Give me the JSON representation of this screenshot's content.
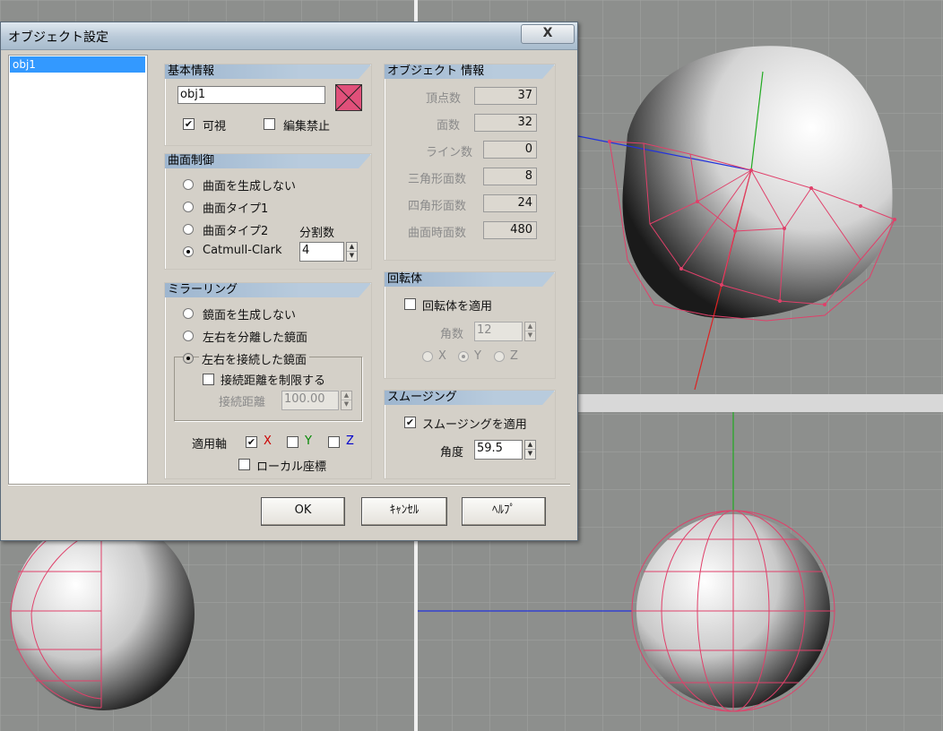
{
  "dialog": {
    "title": "オブジェクト設定",
    "close_label": "X",
    "object_list": [
      "obj1"
    ]
  },
  "basic_info": {
    "header": "基本情報",
    "name_value": "obj1",
    "color": "#e0507a",
    "visible_label": "可視",
    "visible_checked": true,
    "lock_label": "編集禁止",
    "lock_checked": false
  },
  "surface": {
    "header": "曲面制御",
    "options": [
      "曲面を生成しない",
      "曲面タイプ1",
      "曲面タイプ2",
      "Catmull-Clark"
    ],
    "selected_index": 3,
    "subdiv_label": "分割数",
    "subdiv_value": "4"
  },
  "mirror": {
    "header": "ミラーリング",
    "options": [
      "鏡面を生成しない",
      "左右を分離した鏡面",
      "左右を接続した鏡面"
    ],
    "selected_index": 2,
    "limit_label": "接続距離を制限する",
    "limit_checked": false,
    "distance_label": "接続距離",
    "distance_value": "100.00",
    "axis_label": "適用軸",
    "axis_x": "X",
    "axis_y": "Y",
    "axis_z": "Z",
    "axis_x_checked": true,
    "axis_y_checked": false,
    "axis_z_checked": false,
    "axis_x_color": "#cc0000",
    "axis_y_color": "#008800",
    "axis_z_color": "#0000cc",
    "local_label": "ローカル座標",
    "local_checked": false
  },
  "object_info": {
    "header": "オブジェクト 情報",
    "rows": [
      {
        "label": "頂点数",
        "value": "37"
      },
      {
        "label": "面数",
        "value": "32"
      },
      {
        "label": "ライン数",
        "value": "0"
      },
      {
        "label": "三角形面数",
        "value": "8"
      },
      {
        "label": "四角形面数",
        "value": "24"
      },
      {
        "label": "曲面時面数",
        "value": "480"
      }
    ]
  },
  "lathe": {
    "header": "回転体",
    "apply_label": "回転体を適用",
    "apply_checked": false,
    "count_label": "角数",
    "count_value": "12",
    "axis_x": "X",
    "axis_y": "Y",
    "axis_z": "Z",
    "axis_selected": "Y"
  },
  "smoothing": {
    "header": "スムージング",
    "apply_label": "スムージングを適用",
    "apply_checked": true,
    "angle_label": "角度",
    "angle_value": "59.5"
  },
  "buttons": {
    "ok": "OK",
    "cancel": "ｷｬﾝｾﾙ",
    "help": "ﾍﾙﾌﾟ"
  },
  "colors": {
    "mesh_wire": "#e0406a",
    "grid_line": "#a8aaa8",
    "viewport_bg": "#8d8f8d",
    "divider": "#ffffff"
  }
}
